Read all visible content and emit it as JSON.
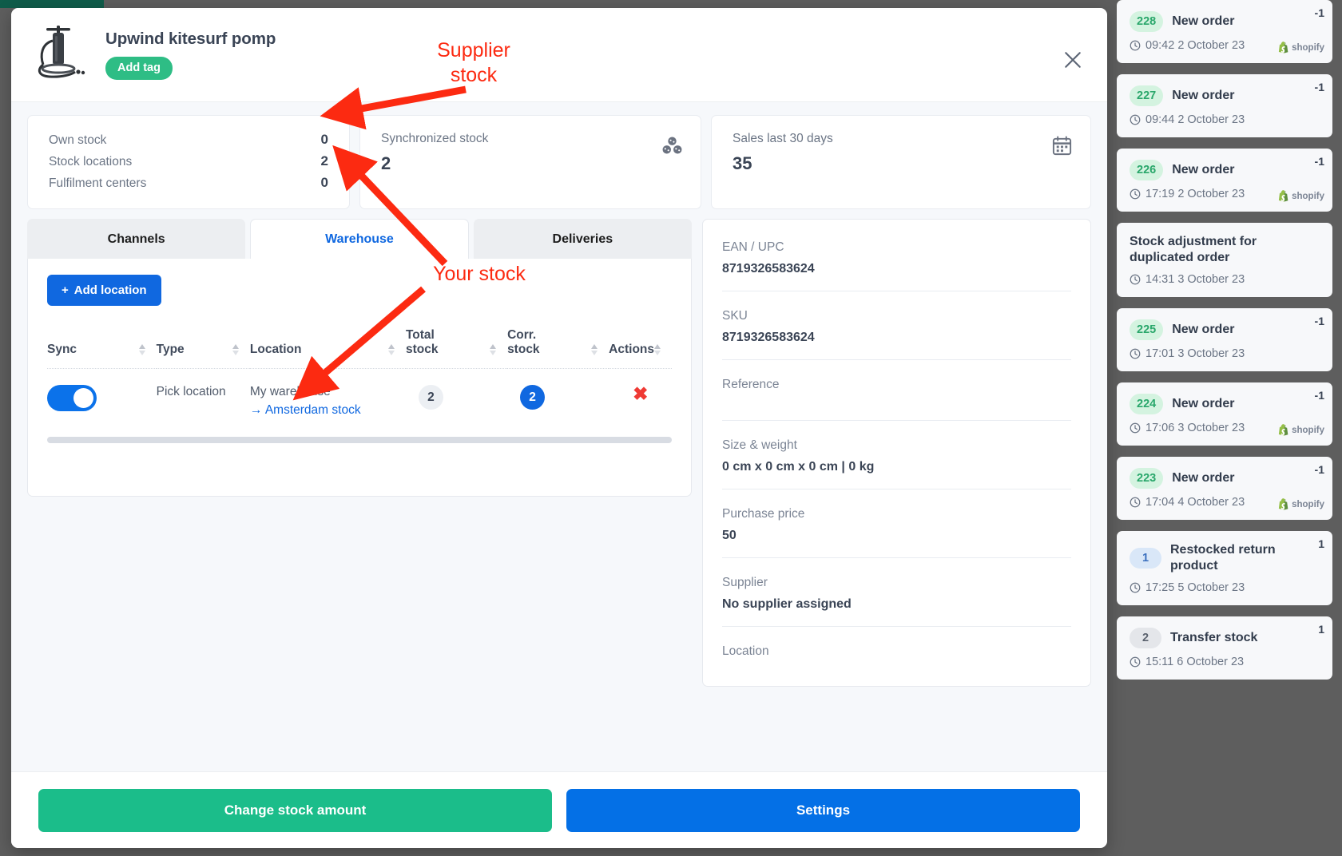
{
  "header": {
    "product_title": "Upwind kitesurf pomp",
    "tag_label": "Add tag",
    "close_icon": "close-icon",
    "thumb_icon": "kitesurf-pump-image"
  },
  "stats": {
    "own_card": {
      "rows": [
        {
          "label": "Own stock",
          "value": "0"
        },
        {
          "label": "Stock locations",
          "value": "2"
        },
        {
          "label": "Fulfilment centers",
          "value": "0"
        }
      ]
    },
    "sync_card": {
      "title": "Synchronized stock",
      "value": "2",
      "icon": "cubes-icon"
    },
    "sales_card": {
      "title": "Sales last 30 days",
      "value": "35",
      "icon": "calendar-icon"
    }
  },
  "tabs": [
    {
      "label": "Channels",
      "active": false
    },
    {
      "label": "Warehouse",
      "active": true
    },
    {
      "label": "Deliveries",
      "active": false
    }
  ],
  "warehouse": {
    "add_location_label": "Add location",
    "add_icon": "plus-icon",
    "columns": [
      "Sync",
      "Type",
      "Location",
      "Total stock",
      "Corr. stock",
      "Actions"
    ],
    "rows": [
      {
        "sync_on": true,
        "type": "Pick location",
        "location_main": "My warehouse",
        "location_link": "Amsterdam stock",
        "location_link_icon": "arrow-right-icon",
        "total_stock": "2",
        "corr_stock": "2",
        "action_icon": "remove-x-icon"
      }
    ]
  },
  "details": [
    {
      "label": "EAN / UPC",
      "value": "8719326583624"
    },
    {
      "label": "SKU",
      "value": "8719326583624"
    },
    {
      "label": "Reference",
      "value": ""
    },
    {
      "label": "Size & weight",
      "value": "0 cm x 0 cm x 0 cm | 0 kg"
    },
    {
      "label": "Purchase price",
      "value": "50"
    },
    {
      "label": "Supplier",
      "value": "No supplier assigned"
    },
    {
      "label": "Location",
      "value": ""
    }
  ],
  "footer": {
    "change_stock_label": "Change stock amount",
    "settings_label": "Settings"
  },
  "activity": [
    {
      "badge": "228",
      "badge_color": "green",
      "title": "New order",
      "time": "09:42 2 October 23",
      "count": "-1",
      "source": "shopify"
    },
    {
      "badge": "227",
      "badge_color": "green",
      "title": "New order",
      "time": "09:44 2 October 23",
      "count": "-1",
      "source": ""
    },
    {
      "badge": "226",
      "badge_color": "green",
      "title": "New order",
      "time": "17:19 2 October 23",
      "count": "-1",
      "source": "shopify"
    },
    {
      "badge": "",
      "badge_color": "",
      "title": "Stock adjustment for duplicated order",
      "time": "14:31 3 October 23",
      "count": "",
      "source": ""
    },
    {
      "badge": "225",
      "badge_color": "green",
      "title": "New order",
      "time": "17:01 3 October 23",
      "count": "-1",
      "source": ""
    },
    {
      "badge": "224",
      "badge_color": "green",
      "title": "New order",
      "time": "17:06 3 October 23",
      "count": "-1",
      "source": "shopify"
    },
    {
      "badge": "223",
      "badge_color": "green",
      "title": "New order",
      "time": "17:04 4 October 23",
      "count": "-1",
      "source": "shopify"
    },
    {
      "badge": "1",
      "badge_color": "blue",
      "title": "Restocked return product",
      "time": "17:25 5 October 23",
      "count": "1",
      "source": ""
    },
    {
      "badge": "2",
      "badge_color": "gray",
      "title": "Transfer stock",
      "time": "15:11 6 October 23",
      "count": "1",
      "source": ""
    }
  ],
  "annotations": [
    {
      "text": "Supplier\nstock",
      "color": "#fc2a11"
    },
    {
      "text": "Your stock",
      "color": "#fc2a11"
    }
  ],
  "colors": {
    "accent_blue": "#1068e0",
    "accent_green": "#1bbd8a",
    "tag_green": "#2ebd85",
    "annotation_red": "#fc2a11",
    "danger_red": "#ef3a34"
  }
}
